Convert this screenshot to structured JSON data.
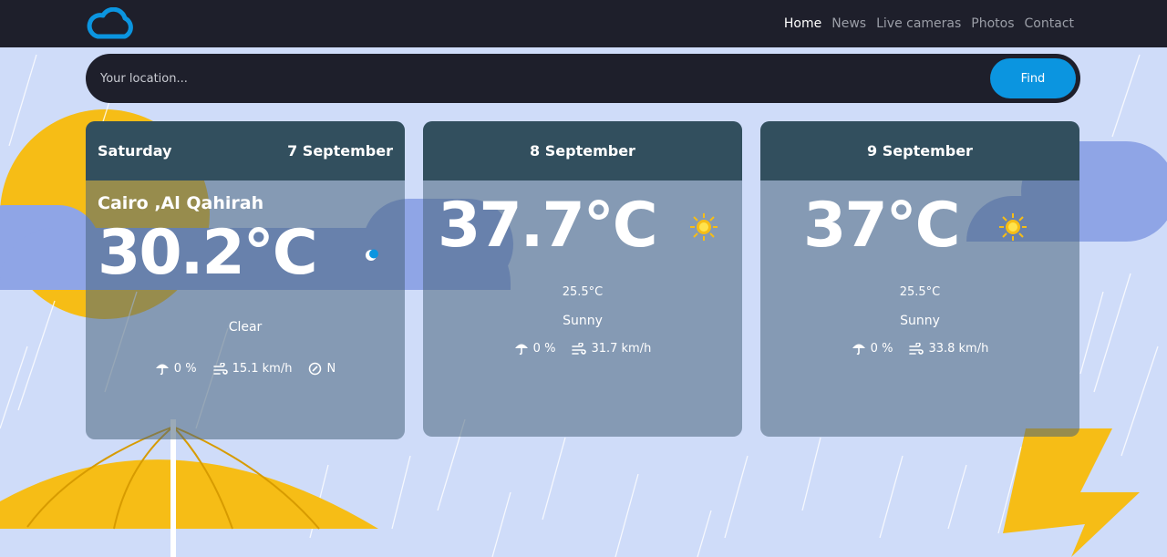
{
  "nav": {
    "logo": "cloud-logo-icon",
    "links": [
      "Home",
      "News",
      "Live cameras",
      "Photos",
      "Contact"
    ],
    "active": "Home"
  },
  "search": {
    "placeholder": "Your location...",
    "value": "",
    "button_label": "Find"
  },
  "today": {
    "day": "Saturday",
    "date": "7 September",
    "location": "Cairo ,Al Qahirah",
    "temp": "30.2°C",
    "condition": "Clear",
    "condition_icon": "moon-icon",
    "rain_chance": "0 %",
    "wind_speed": "15.1 km/h",
    "wind_dir": "N"
  },
  "forecast": [
    {
      "date": "8 September",
      "max_temp": "37.7°C",
      "min_temp": "25.5°C",
      "condition": "Sunny",
      "condition_icon": "sun-icon",
      "rain_chance": "0 %",
      "wind_speed": "31.7 km/h"
    },
    {
      "date": "9 September",
      "max_temp": "37°C",
      "min_temp": "25.5°C",
      "condition": "Sunny",
      "condition_icon": "sun-icon",
      "rain_chance": "0 %",
      "wind_speed": "33.8 km/h"
    }
  ],
  "colors": {
    "navbar": "#1e1f2b",
    "accent": "#0b95e0",
    "card_header": "#324f5e",
    "background": "#cfdcf9",
    "sun": "#f6bd16"
  }
}
